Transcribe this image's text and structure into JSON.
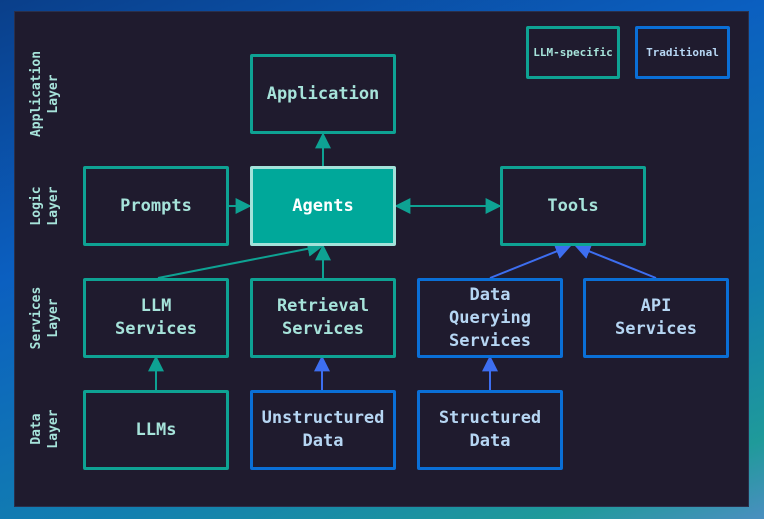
{
  "legend": {
    "llm_specific": "LLM-specific",
    "traditional": "Traditional"
  },
  "colors": {
    "llm_specific": "#0ea293",
    "traditional": "#0a6fd6",
    "agents_fill": "#00a89a",
    "background": "#1f1b2e"
  },
  "layers": {
    "application": "Application\nLayer",
    "logic": "Logic\nLayer",
    "services": "Services\nLayer",
    "data": "Data\nLayer"
  },
  "nodes": {
    "application": "Application",
    "prompts": "Prompts",
    "agents": "Agents",
    "tools": "Tools",
    "llm_services": "LLM\nServices",
    "retrieval_services": "Retrieval\nServices",
    "data_querying_services": "Data\nQuerying\nServices",
    "api_services": "API\nServices",
    "llms": "LLMs",
    "unstructured_data": "Unstructured\nData",
    "structured_data": "Structured\nData"
  },
  "edges": [
    {
      "from": "agents",
      "to": "application",
      "type": "llm"
    },
    {
      "from": "prompts",
      "to": "agents",
      "type": "llm"
    },
    {
      "from": "agents",
      "to": "tools",
      "type": "llm",
      "bidirectional": true
    },
    {
      "from": "llm_services",
      "to": "agents",
      "type": "llm"
    },
    {
      "from": "retrieval_services",
      "to": "agents",
      "type": "llm"
    },
    {
      "from": "data_querying_services",
      "to": "tools",
      "type": "traditional"
    },
    {
      "from": "api_services",
      "to": "tools",
      "type": "traditional"
    },
    {
      "from": "llms",
      "to": "llm_services",
      "type": "llm"
    },
    {
      "from": "unstructured_data",
      "to": "retrieval_services",
      "type": "traditional"
    },
    {
      "from": "structured_data",
      "to": "data_querying_services",
      "type": "traditional"
    }
  ]
}
